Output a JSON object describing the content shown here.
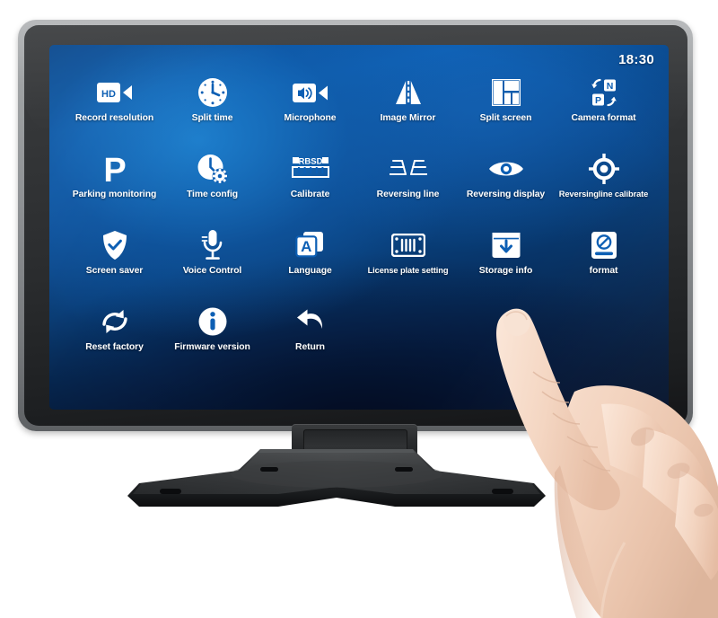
{
  "device": {
    "type": "car-monitor-touchscreen",
    "bezel_color": "#2a2c2e",
    "frame_color": "#9fa2a4"
  },
  "screen": {
    "accent_color": "#0d5fb4",
    "background_dark": "#04142f",
    "text_color": "#ffffff",
    "status_bar": {
      "time": "18:30"
    },
    "menu": {
      "columns": 6,
      "items": [
        {
          "id": "record-resolution",
          "label": "Record resolution",
          "icon": "hd-camcorder-icon"
        },
        {
          "id": "split-time",
          "label": "Split time",
          "icon": "clock-icon"
        },
        {
          "id": "microphone",
          "label": "Microphone",
          "icon": "speaker-camcorder-icon"
        },
        {
          "id": "image-mirror",
          "label": "Image Mirror",
          "icon": "mirror-triangles-icon"
        },
        {
          "id": "split-screen",
          "label": "Split screen",
          "icon": "grid-layout-icon"
        },
        {
          "id": "camera-format",
          "label": "Camera format",
          "icon": "np-swap-icon"
        },
        {
          "id": "parking-monitoring",
          "label": "Parking monitoring",
          "icon": "parking-p-icon"
        },
        {
          "id": "time-config",
          "label": "Time config",
          "icon": "clock-gear-icon"
        },
        {
          "id": "calibrate",
          "label": "Calibrate",
          "icon": "rbsd-ruler-icon"
        },
        {
          "id": "reversing-line",
          "label": "Reversing line",
          "icon": "reversing-lines-icon"
        },
        {
          "id": "reversing-display",
          "label": "Reversing display",
          "icon": "eye-icon"
        },
        {
          "id": "reversingline-calibrate",
          "label": "Reversingline calibrate",
          "icon": "crosshair-target-icon"
        },
        {
          "id": "screen-saver",
          "label": "Screen saver",
          "icon": "shield-check-icon"
        },
        {
          "id": "voice-control",
          "label": "Voice Control",
          "icon": "microphone-icon"
        },
        {
          "id": "language",
          "label": "Language",
          "icon": "letter-a-cards-icon"
        },
        {
          "id": "license-plate-setting",
          "label": "License plate setting",
          "icon": "license-plate-icon"
        },
        {
          "id": "storage-info",
          "label": "Storage info",
          "icon": "storage-download-icon"
        },
        {
          "id": "format",
          "label": "format",
          "icon": "disk-blocked-icon"
        },
        {
          "id": "reset-factory",
          "label": "Reset factory",
          "icon": "refresh-cycle-icon"
        },
        {
          "id": "firmware-version",
          "label": "Firmware version",
          "icon": "info-circle-icon"
        },
        {
          "id": "return",
          "label": "Return",
          "icon": "back-arrow-icon"
        }
      ]
    }
  },
  "calibrate_icon_text": "RBSD",
  "camera_format_icon_text": {
    "top": "N",
    "bottom": "P"
  },
  "hd_icon_text": "HD",
  "language_icon_text": "A",
  "parking_icon_text": "P"
}
